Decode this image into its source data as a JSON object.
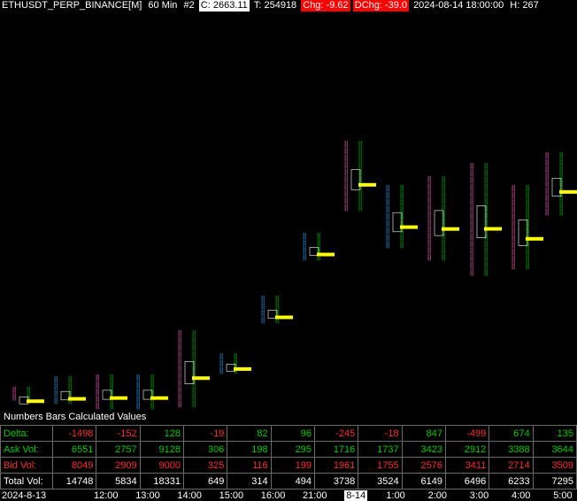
{
  "header": {
    "symbol": "ETHUSDT_PERP_BINANCE[M]",
    "interval": "60 Min",
    "chart_no": "#2",
    "close_label": "C: 2663.11",
    "trades_label": "T: 254918",
    "chg_label": "Chg: -9.62",
    "dchg_label": "DChg: -39.0",
    "datetime_label": "2024-08-14 18:00:00",
    "high_label": "H: 267"
  },
  "panel_title": "Numbers Bars Calculated Values",
  "colors": {
    "up": "#00cc00",
    "down": "#ff2b2b",
    "poc": "#ffff00",
    "pink": "#ff66cc",
    "cyan": "#33aaff"
  },
  "stats": {
    "rows": [
      {
        "label": "Delta:",
        "values": [
          "-1498",
          "-152",
          "128",
          "-19",
          "82",
          "96",
          "-245",
          "-18",
          "847",
          "-499",
          "674",
          "135"
        ],
        "colors": [
          "r",
          "r",
          "g",
          "r",
          "g",
          "g",
          "r",
          "r",
          "g",
          "r",
          "g",
          "g"
        ]
      },
      {
        "label": "Ask Vol:",
        "values": [
          "6551",
          "2757",
          "9128",
          "306",
          "198",
          "295",
          "1716",
          "1737",
          "3423",
          "2912",
          "3388",
          "3644"
        ],
        "colors": [
          "g",
          "g",
          "g",
          "g",
          "g",
          "g",
          "g",
          "g",
          "g",
          "g",
          "g",
          "g"
        ]
      },
      {
        "label": "Bid Vol:",
        "values": [
          "8049",
          "2909",
          "9000",
          "325",
          "116",
          "199",
          "1961",
          "1755",
          "2576",
          "3411",
          "2714",
          "3509"
        ],
        "colors": [
          "r",
          "r",
          "r",
          "r",
          "r",
          "r",
          "r",
          "r",
          "r",
          "r",
          "r",
          "r"
        ]
      },
      {
        "label": "Total Vol:",
        "values": [
          "14748",
          "5834",
          "18331",
          "649",
          "314",
          "494",
          "3738",
          "3524",
          "6149",
          "6496",
          "6233",
          "7295"
        ],
        "colors": [
          "w",
          "w",
          "w",
          "w",
          "w",
          "w",
          "w",
          "w",
          "w",
          "w",
          "w",
          "w"
        ]
      }
    ]
  },
  "time_axis": {
    "date_label": "2024-8-13",
    "labels": [
      "12:00",
      "13:00",
      "14:00",
      "15:00",
      "16:00",
      "21:00",
      "8-14",
      "1:00",
      "2:00",
      "3:00",
      "4:00",
      "5:00"
    ],
    "selected_index": 6
  }
}
